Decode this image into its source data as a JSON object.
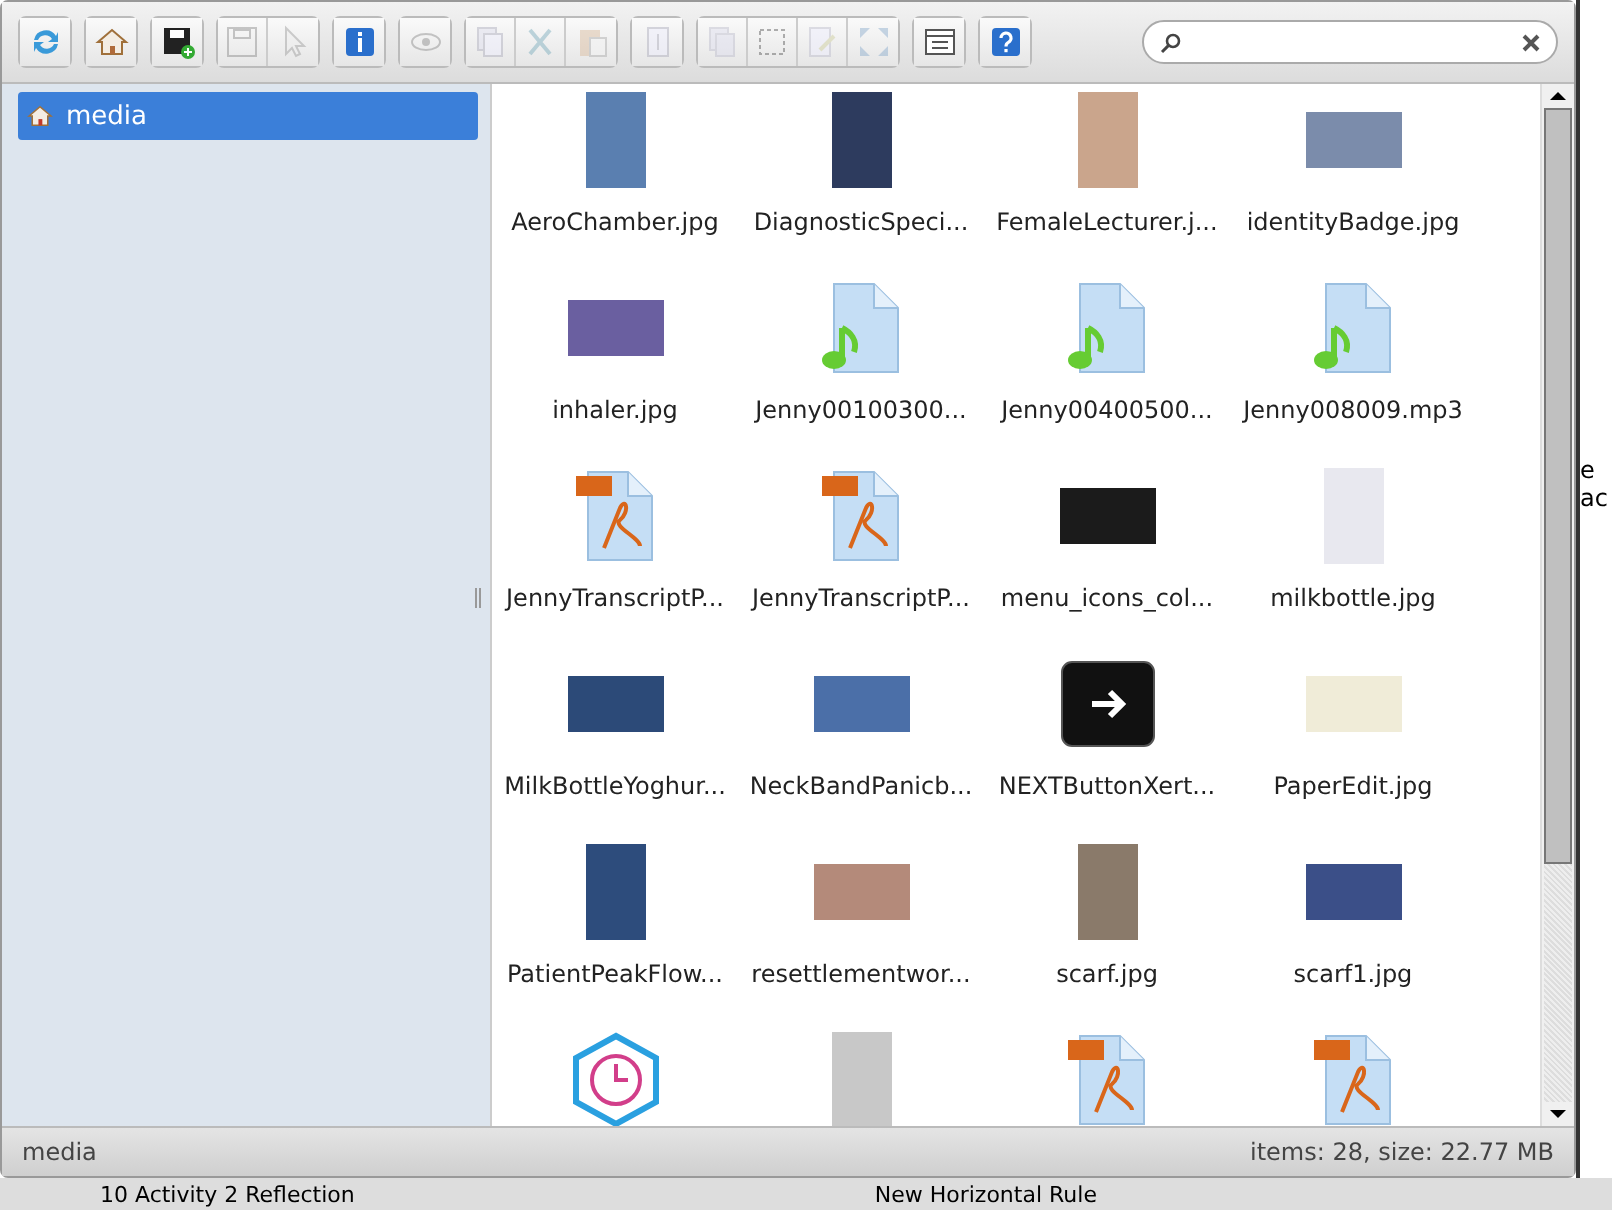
{
  "toolbar": {
    "groups": [
      {
        "buttons": [
          {
            "disabled": false
          }
        ]
      },
      {
        "buttons": [
          {
            "disabled": false
          }
        ]
      },
      {
        "buttons": [
          {
            "disabled": false
          }
        ]
      },
      {
        "buttons": [
          {
            "disabled": true
          },
          {
            "disabled": true
          }
        ]
      },
      {
        "buttons": [
          {
            "disabled": false
          }
        ]
      },
      {
        "buttons": [
          {
            "disabled": true
          }
        ]
      },
      {
        "buttons": [
          {
            "disabled": true
          },
          {
            "disabled": true
          },
          {
            "disabled": true
          }
        ]
      },
      {
        "buttons": [
          {
            "disabled": true
          }
        ]
      },
      {
        "buttons": [
          {
            "disabled": true
          },
          {
            "disabled": true
          },
          {
            "disabled": true
          },
          {
            "disabled": true
          }
        ]
      },
      {
        "buttons": [
          {
            "disabled": false
          }
        ]
      },
      {
        "buttons": [
          {
            "disabled": false
          }
        ]
      }
    ]
  },
  "sidebar": {
    "items": [
      {
        "label": "media",
        "selected": true
      }
    ]
  },
  "files": [
    {
      "name": "AeroChamber.jpg",
      "kind": "photo",
      "landscape": false
    },
    {
      "name": "DiagnosticSpeci...",
      "kind": "photo",
      "landscape": false
    },
    {
      "name": "FemaleLecturer.j...",
      "kind": "photo",
      "landscape": false
    },
    {
      "name": "identityBadge.jpg",
      "kind": "photo",
      "landscape": true
    },
    {
      "name": "inhaler.jpg",
      "kind": "photo",
      "landscape": true
    },
    {
      "name": "Jenny00100300...",
      "kind": "audio"
    },
    {
      "name": "Jenny00400500...",
      "kind": "audio"
    },
    {
      "name": "Jenny008009.mp3",
      "kind": "audio"
    },
    {
      "name": "JennyTranscriptP...",
      "kind": "pdf"
    },
    {
      "name": "JennyTranscriptP...",
      "kind": "pdf"
    },
    {
      "name": "menu_icons_col...",
      "kind": "photo",
      "landscape": true
    },
    {
      "name": "milkbottle.jpg",
      "kind": "photo",
      "landscape": false
    },
    {
      "name": "MilkBottleYoghur...",
      "kind": "photo",
      "landscape": true
    },
    {
      "name": "NeckBandPanicb...",
      "kind": "photo",
      "landscape": true
    },
    {
      "name": "NEXTButtonXert...",
      "kind": "button-graphic"
    },
    {
      "name": "PaperEdit.jpg",
      "kind": "photo",
      "landscape": true
    },
    {
      "name": "PatientPeakFlow...",
      "kind": "photo",
      "landscape": false
    },
    {
      "name": "resettlementwor...",
      "kind": "photo",
      "landscape": true
    },
    {
      "name": "scarf.jpg",
      "kind": "photo",
      "landscape": false
    },
    {
      "name": "scarf1.jpg",
      "kind": "photo",
      "landscape": true
    },
    {
      "kind": "clock"
    },
    {
      "kind": "photo",
      "landscape": false
    },
    {
      "kind": "pdf"
    },
    {
      "kind": "pdf"
    }
  ],
  "status_bar": {
    "path": "media",
    "summary": "items: 28, size: 22.77 MB"
  },
  "background": {
    "side_texts": [
      "e",
      "ac"
    ],
    "bottom_texts": [
      "10 Activity 2 Reflection",
      "New Horizontal Rule"
    ]
  }
}
